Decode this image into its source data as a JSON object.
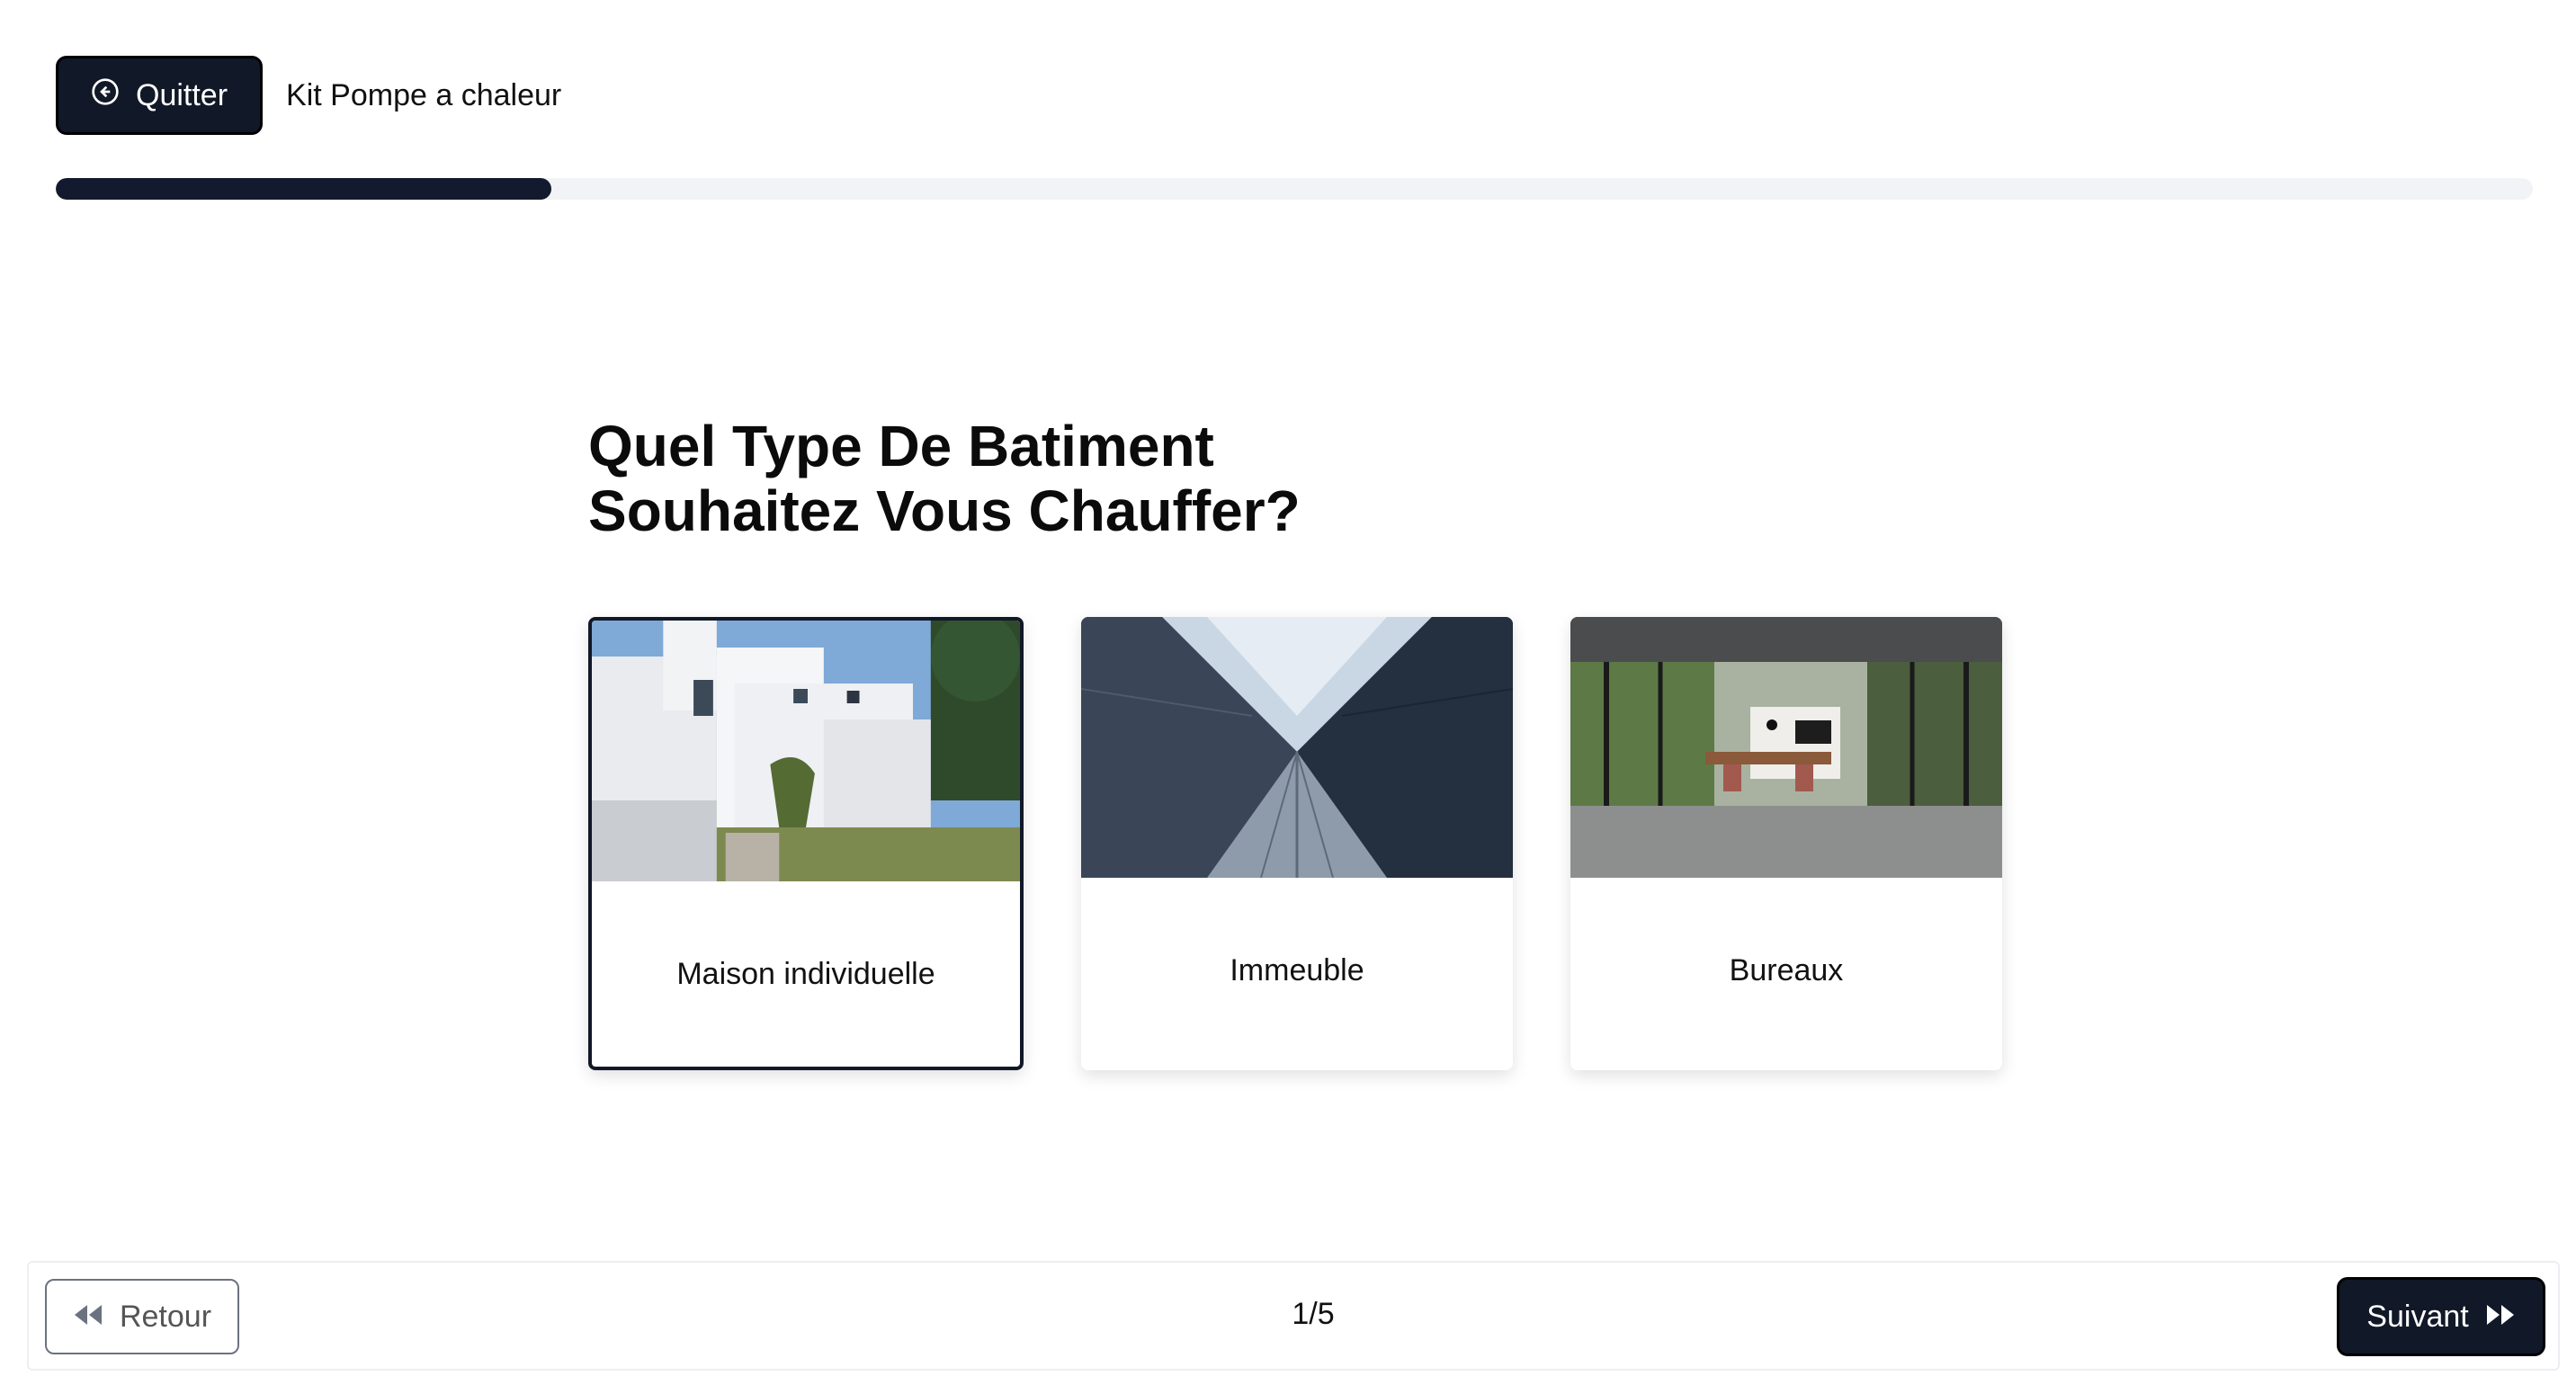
{
  "header": {
    "quit_label": "Quitter",
    "kit_title": "Kit Pompe a chaleur"
  },
  "progress": {
    "fraction": 0.2
  },
  "question": {
    "title": "Quel Type De Batiment Souhaitez Vous Chauffer?"
  },
  "options": [
    {
      "label": "Maison individuelle",
      "image": "house-photo",
      "selected": true
    },
    {
      "label": "Immeuble",
      "image": "tower-photo",
      "selected": false
    },
    {
      "label": "Bureaux",
      "image": "office-photo",
      "selected": false
    }
  ],
  "footer": {
    "back_label": "Retour",
    "step": "1/5",
    "next_label": "Suivant"
  },
  "colors": {
    "primary": "#111827",
    "progress_track": "#f1f3f6"
  }
}
